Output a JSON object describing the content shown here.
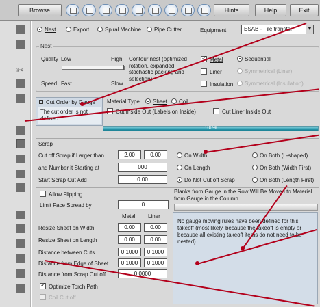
{
  "toolbar": {
    "browse": "Browse",
    "hints": "Hints",
    "help": "Help",
    "exit": "Exit"
  },
  "mode": {
    "nest": "Nest",
    "export": "Export",
    "spiral": "Spiral Machine",
    "pipe": "Pipe Cutter",
    "selected": "nest",
    "equipment_label": "Equipment",
    "equipment_value": "ESAB - File transfer"
  },
  "nest_group": {
    "title": "Nest",
    "quality_label": "Quality",
    "quality_low": "Low",
    "quality_high": "High",
    "speed_label": "Speed",
    "speed_fast": "Fast",
    "speed_slow": "Slow",
    "description": "Contour nest (optimized rotation, expanded stochastic packing and selection)",
    "metal": "Metal",
    "liner": "Liner",
    "insulation": "Insulation",
    "sequential": "Sequential",
    "symmetrical_liner": "Symmetrical (Liner)",
    "symmetrical_insulation": "Symmetrical (Insulation)"
  },
  "cut_order": {
    "tab": "Cut Order by Gauge",
    "message": "The cut order is not defined."
  },
  "material": {
    "label": "Material Type",
    "sheet": "Sheet",
    "coil": "Coil",
    "cut_inside_out": "Cut Inside Out (Labels on Inside)",
    "cut_liner_inside_out": "Cut Liner Inside Out"
  },
  "progress": {
    "label": "100%",
    "value": 1.0
  },
  "scrap": {
    "title": "Scrap",
    "cut_off_label": "Cut off Scrap if Larger than",
    "cut_off_a": "2.00",
    "cut_off_b": "0.00",
    "number_label": "and Number it Starting at",
    "number_value": "000",
    "start_label": "Start Scrap Cut Add",
    "start_value": "0.00",
    "on_width": "On Width",
    "on_length": "On Length",
    "do_not_cut": "Do Not Cut off Scrap",
    "on_both_l": "On Both (L-shaped)",
    "on_both_width": "On Both (Width First)",
    "on_both_length": "On Both (Length First)"
  },
  "settings": {
    "allow_flipping": "Allow Flipping",
    "limit_face_label": "Limit Face Spread by",
    "limit_face_value": "0",
    "col_metal": "Metal",
    "col_liner": "Liner",
    "resize_width_label": "Resize Sheet on Width",
    "resize_width_metal": "0.00",
    "resize_width_liner": "0.00",
    "resize_length_label": "Resize Sheet on Length",
    "resize_length_metal": "0.00",
    "resize_length_liner": "0.00",
    "distance_cuts_label": "Distance between Cuts",
    "distance_cuts_metal": "0.1000",
    "distance_cuts_liner": "0.1000",
    "distance_edge_label": "Distance from Edge of Sheet",
    "distance_edge_metal": "0.1000",
    "distance_edge_liner": "0.1000",
    "distance_scrap_label": "Distance from Scrap Cut off",
    "distance_scrap_value": "0.0000",
    "optimize_torch": "Optimize Torch Path",
    "coil_cut_off": "Coil Cut off"
  },
  "gauge_rules": {
    "header": "Blanks from Gauge in the Row Will Be Moved to Material from Gauge in the Column",
    "message": "No gauge moving rules have been defined for this takeoff (most likely, because the takeoff is empty or because all existing takeoff items do not need to be nested)."
  },
  "colors": {
    "annotation_red": "#b3001b",
    "progress_teal": "#2a9bb0"
  }
}
